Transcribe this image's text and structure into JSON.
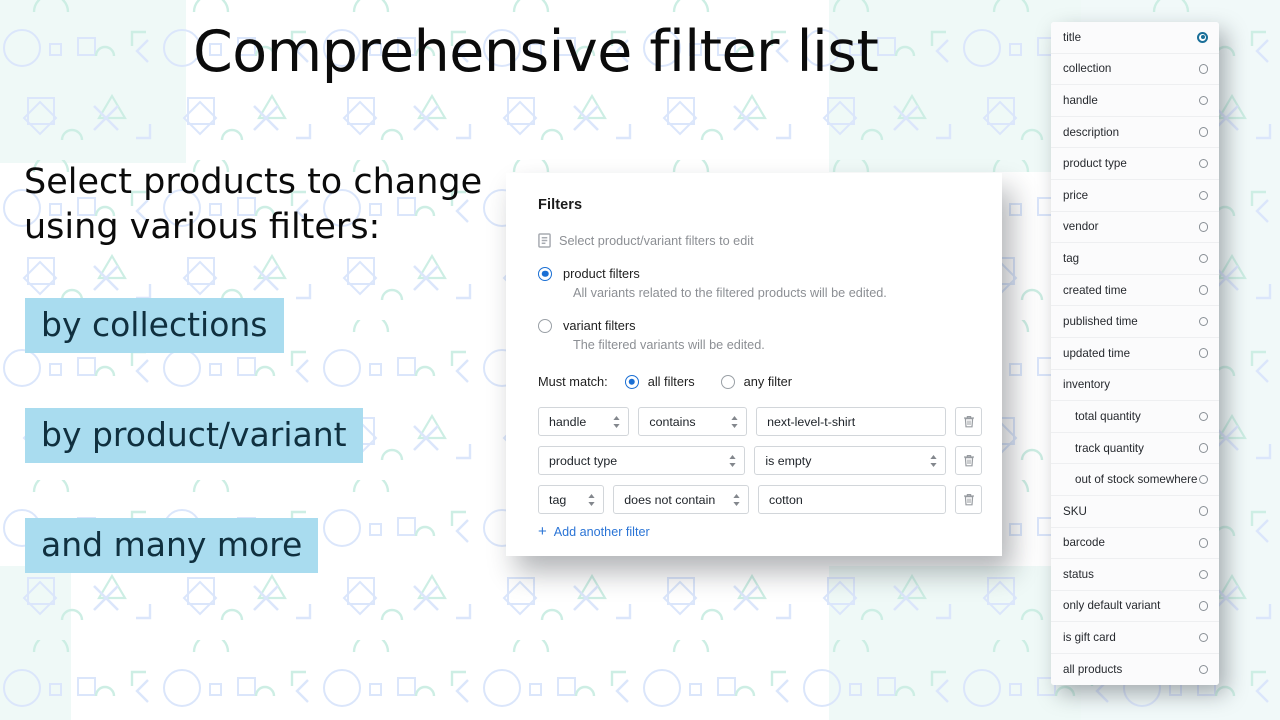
{
  "slide": {
    "headline": "Comprehensive filter list",
    "subhead": "Select products to change using various filters:",
    "highlights": [
      "by collections",
      "by product/variant",
      "and many more"
    ],
    "accent_highlight_color": "#a9dcef",
    "accent_text_color": "#10303f",
    "background_tint_color": "#ecf8f6"
  },
  "filters_dialog": {
    "title": "Filters",
    "subtitle": "Select product/variant filters to edit",
    "subtitle_icon": "document-icon",
    "scope_options": [
      {
        "label": "product filters",
        "help": "All variants related to the filtered products will be edited.",
        "selected": true
      },
      {
        "label": "variant filters",
        "help": "The filtered variants will be edited.",
        "selected": false
      }
    ],
    "must_match": {
      "label": "Must match:",
      "options": [
        {
          "label": "all filters",
          "selected": true
        },
        {
          "label": "any filter",
          "selected": false
        }
      ]
    },
    "filter_rows": [
      {
        "field": "handle",
        "operator": "contains",
        "value": "next-level-t-shirt",
        "has_value": true,
        "field_width": 94,
        "operator_width": 112,
        "value_width": 196
      },
      {
        "field": "product type",
        "operator": "is empty",
        "value": "",
        "has_value": false,
        "field_width": 212,
        "operator_width": 196,
        "value_width": 0
      },
      {
        "field": "tag",
        "operator": "does not contain",
        "value": "cotton",
        "has_value": true,
        "field_width": 68,
        "operator_width": 140,
        "value_width": 194
      }
    ],
    "add_filter_label": "Add another filter",
    "add_filter_icon": "plus-icon",
    "delete_icon": "trash-icon",
    "accent_color": "#1a6fd4",
    "link_color": "#2a74d6"
  },
  "field_list": {
    "selected_radio_color": "#1a6f99",
    "items": [
      {
        "label": "title",
        "selected": true,
        "indent": false,
        "has_radio": true
      },
      {
        "label": "collection",
        "selected": false,
        "indent": false,
        "has_radio": true
      },
      {
        "label": "handle",
        "selected": false,
        "indent": false,
        "has_radio": true
      },
      {
        "label": "description",
        "selected": false,
        "indent": false,
        "has_radio": true
      },
      {
        "label": "product type",
        "selected": false,
        "indent": false,
        "has_radio": true
      },
      {
        "label": "price",
        "selected": false,
        "indent": false,
        "has_radio": true
      },
      {
        "label": "vendor",
        "selected": false,
        "indent": false,
        "has_radio": true
      },
      {
        "label": "tag",
        "selected": false,
        "indent": false,
        "has_radio": true
      },
      {
        "label": "created time",
        "selected": false,
        "indent": false,
        "has_radio": true
      },
      {
        "label": "published time",
        "selected": false,
        "indent": false,
        "has_radio": true
      },
      {
        "label": "updated time",
        "selected": false,
        "indent": false,
        "has_radio": true
      },
      {
        "label": "inventory",
        "selected": false,
        "indent": false,
        "has_radio": false
      },
      {
        "label": "total quantity",
        "selected": false,
        "indent": true,
        "has_radio": true
      },
      {
        "label": "track quantity",
        "selected": false,
        "indent": true,
        "has_radio": true
      },
      {
        "label": "out of stock somewhere",
        "selected": false,
        "indent": true,
        "has_radio": true
      },
      {
        "label": "SKU",
        "selected": false,
        "indent": false,
        "has_radio": true
      },
      {
        "label": "barcode",
        "selected": false,
        "indent": false,
        "has_radio": true
      },
      {
        "label": "status",
        "selected": false,
        "indent": false,
        "has_radio": true
      },
      {
        "label": "only default variant",
        "selected": false,
        "indent": false,
        "has_radio": true
      },
      {
        "label": "is gift card",
        "selected": false,
        "indent": false,
        "has_radio": true
      },
      {
        "label": "all products",
        "selected": false,
        "indent": false,
        "has_radio": true
      }
    ]
  }
}
